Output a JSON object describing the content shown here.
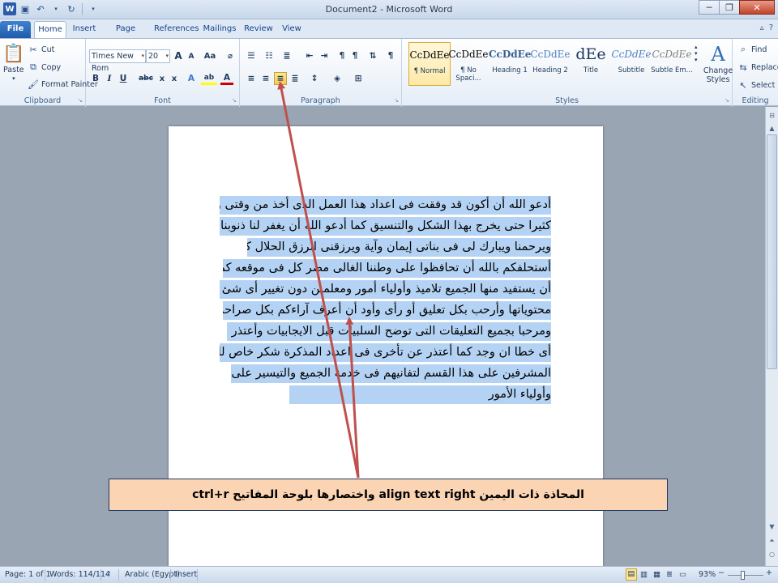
{
  "window": {
    "title": "Document2 - Microsoft Word",
    "logo": "W",
    "minimize": "─",
    "restore": "❐",
    "close": "✕"
  },
  "tabs": [
    {
      "label": "File"
    },
    {
      "label": "Home"
    },
    {
      "label": "Insert"
    },
    {
      "label": "Page Layout"
    },
    {
      "label": "References"
    },
    {
      "label": "Mailings"
    },
    {
      "label": "Review"
    },
    {
      "label": "View"
    }
  ],
  "ribbon": {
    "clipboard": {
      "label": "Clipboard",
      "paste": "Paste",
      "cut": "Cut",
      "copy": "Copy",
      "format_painter": "Format Painter"
    },
    "font": {
      "label": "Font",
      "font_name": "Times New Rom",
      "font_size": "20",
      "grow": "A",
      "shrink": "A",
      "change_case": "Aa",
      "bold": "B",
      "italic": "I",
      "underline": "U",
      "strikethrough": "abc",
      "subscript": "x",
      "superscript": "x",
      "text_effects": "A",
      "highlight": "ab",
      "font_color": "A"
    },
    "paragraph": {
      "label": "Paragraph",
      "selected_button": "align-text-right"
    },
    "styles": {
      "label": "Styles",
      "items": [
        {
          "preview": "CcDdEe",
          "name": "¶ Normal"
        },
        {
          "preview": "CcDdEe",
          "name": "¶ No Spaci..."
        },
        {
          "preview": "CcDdEe",
          "name": "Heading 1"
        },
        {
          "preview": "CcDdEe",
          "name": "Heading 2"
        },
        {
          "preview": "dEe",
          "name": "Title"
        },
        {
          "preview": "CcDdEe",
          "name": "Subtitle"
        },
        {
          "preview": "CcDdEe",
          "name": "Subtle Em..."
        }
      ],
      "change_styles_line1": "Change",
      "change_styles_line2": "Styles"
    },
    "editing": {
      "label": "Editing",
      "find": "Find",
      "replace": "Replace",
      "select": "Select"
    }
  },
  "document": {
    "lines": [
      "أدعو الله أن أكون قد وفقت فى اعداد هذا العمل الذى أخذ من وقتى وجهدى",
      "كثيرا حتى يخرج بهذا الشكل والتنسيق كما أدعو الله أن يغفر لنا ذنوبنا",
      "ويرحمنا ويبارك لى فى بناتى إيمان وآية ويرزقنى الرزق الحلال كما",
      "أستحلفكم بالله أن تحافظوا على وطننا الغالى مصر كل فى موقعه كما أرجو",
      "أن يستفيد منها الجميع تلاميذ وأولياء أمور ومعلمين دون تغيير أى شئ فى",
      "محتوياتها وأرحب بكل تعليق أو رأى وأود أن أعرف آراءكم بكل صراحة",
      "ومرحبا بجميع التعليقات التى توضح السلبيات قبل الايجابيات وأعتذر عن",
      "أى خطا ان وجد كما أعتذر عن تأخرى فى اعداد المذكرة شكر خاص للسادة",
      "المشرفين على هذا القسم لتفانيهم فى خدمة الجميع والتيسير على المعلمين",
      "وأولياء الأمور"
    ]
  },
  "annotation": {
    "text": "المحاذة ذات اليمين align text right واختصارها بلوحة المفاتيح ctrl+r"
  },
  "statusbar": {
    "page": "Page: 1 of 1",
    "words": "Words: 114/114",
    "language": "Arabic (Egypt)",
    "mode": "Insert",
    "zoom": "93%",
    "zoom_out": "−",
    "zoom_in": "+"
  },
  "colors": {
    "selection": "#b4d3f4",
    "arrow": "#c0504d",
    "callout_fill": "#fbd4b4"
  }
}
